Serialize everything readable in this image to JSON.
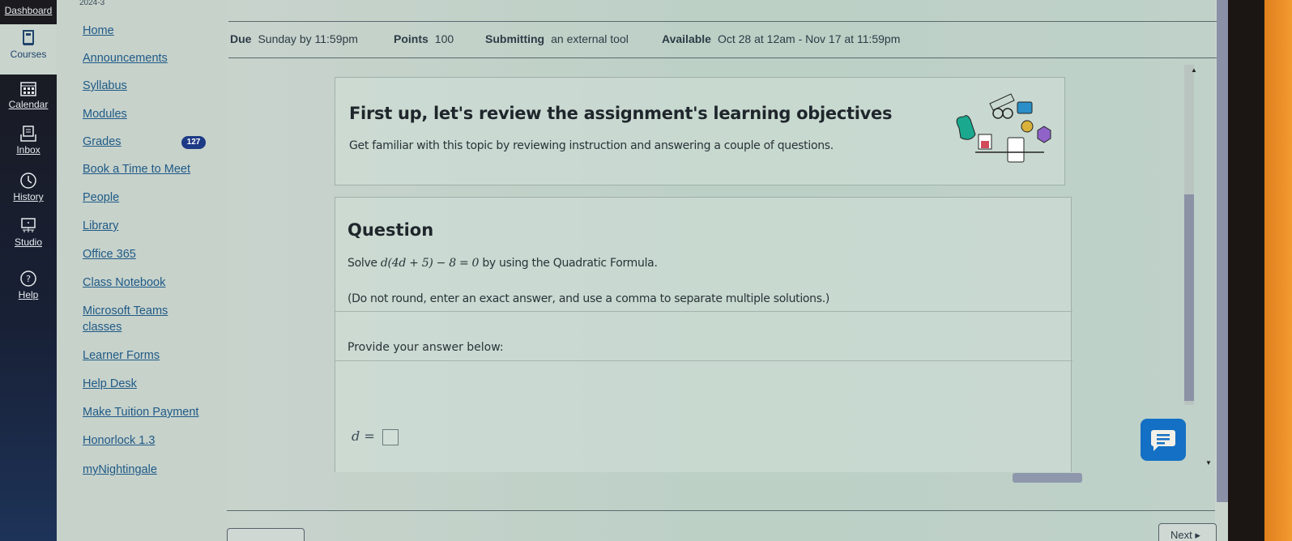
{
  "global_nav": {
    "term": "2024-3",
    "items": [
      {
        "label": "Dashboard",
        "icon": "dashboard-icon"
      },
      {
        "label": "Courses",
        "icon": "book-icon",
        "active": true
      },
      {
        "label": "Calendar",
        "icon": "calendar-icon"
      },
      {
        "label": "Inbox",
        "icon": "inbox-icon"
      },
      {
        "label": "History",
        "icon": "clock-icon"
      },
      {
        "label": "Studio",
        "icon": "studio-icon"
      },
      {
        "label": "Help",
        "icon": "help-icon"
      }
    ]
  },
  "course_nav": {
    "items": [
      {
        "label": "Home"
      },
      {
        "label": "Announcements"
      },
      {
        "label": "Syllabus"
      },
      {
        "label": "Modules"
      },
      {
        "label": "Grades",
        "badge": "127"
      },
      {
        "label": "Book a Time to Meet"
      },
      {
        "label": "People"
      },
      {
        "label": "Library"
      },
      {
        "label": "Office 365"
      },
      {
        "label": "Class Notebook"
      },
      {
        "label": "Microsoft Teams"
      },
      {
        "label": "classes"
      },
      {
        "label": "Learner Forms"
      },
      {
        "label": "Help Desk"
      },
      {
        "label": "Make Tuition Payment"
      },
      {
        "label": "Honorlock 1.3"
      },
      {
        "label": "myNightingale"
      }
    ]
  },
  "assignment_meta": {
    "due_label": "Due",
    "due_value": "Sunday by 11:59pm",
    "points_label": "Points",
    "points_value": "100",
    "submitting_label": "Submitting",
    "submitting_value": "an external tool",
    "available_label": "Available",
    "available_value": "Oct 28 at 12am - Nov 17 at 11:59pm"
  },
  "objectives": {
    "title": "First up, let's review the assignment's learning objectives",
    "subtitle": "Get familiar with this topic by reviewing instruction and answering a couple of questions."
  },
  "question": {
    "title": "Question",
    "prefix": "Solve ",
    "equation": "d(4d + 5) − 8 = 0",
    "suffix": " by using the Quadratic Formula.",
    "note": "(Do not round, enter an exact answer, and use a comma to separate multiple solutions.)",
    "prompt": "Provide your answer below:",
    "answer_label": "d =",
    "answer_value": ""
  },
  "footer": {
    "next_label": "Next ▸"
  },
  "colors": {
    "link": "#1f5a86",
    "badge": "#1d3a86",
    "chat_button": "#1470c4"
  }
}
